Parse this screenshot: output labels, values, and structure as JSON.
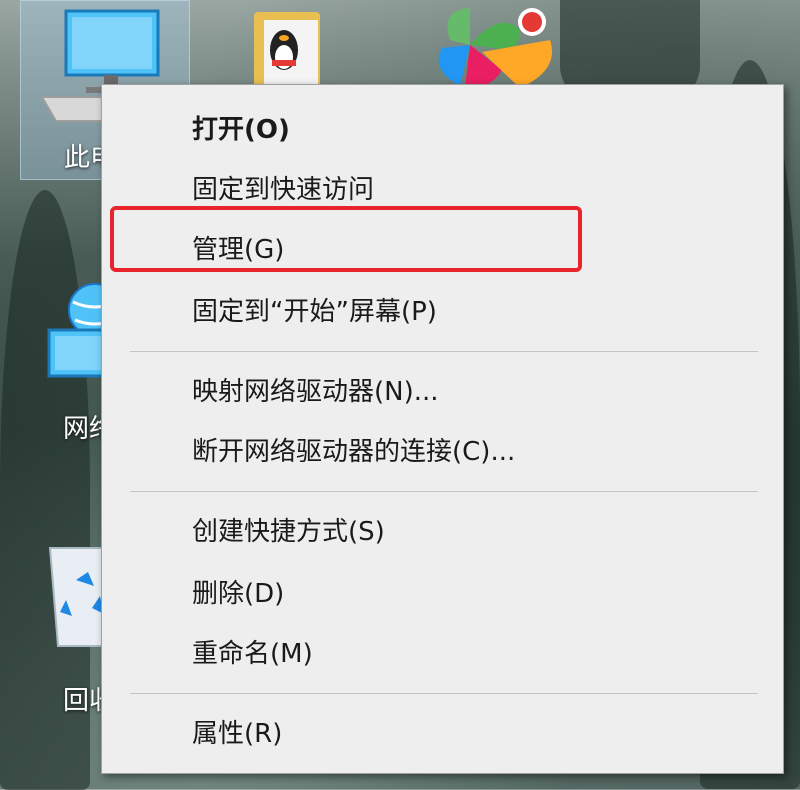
{
  "desktop": {
    "icons": [
      {
        "label": "此电脑"
      },
      {
        "label": "网络"
      },
      {
        "label": "回收站"
      }
    ],
    "highlight_color": "#e8242c"
  },
  "context_menu": {
    "items": [
      {
        "label": "打开(O)"
      },
      {
        "label": "固定到快速访问"
      },
      {
        "label": "管理(G)"
      },
      {
        "label": "固定到“开始”屏幕(P)"
      },
      {
        "label": "映射网络驱动器(N)..."
      },
      {
        "label": "断开网络驱动器的连接(C)..."
      },
      {
        "label": "创建快捷方式(S)"
      },
      {
        "label": "删除(D)"
      },
      {
        "label": "重命名(M)"
      },
      {
        "label": "属性(R)"
      }
    ]
  }
}
